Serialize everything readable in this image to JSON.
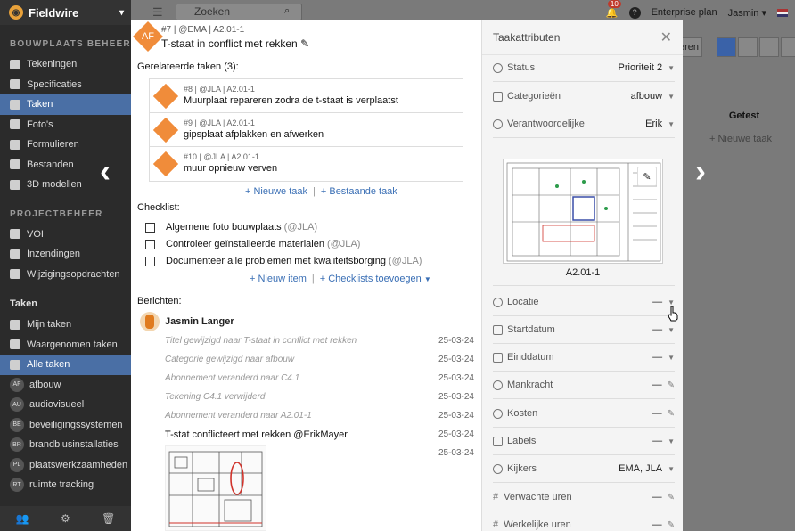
{
  "app": {
    "brand": "Fieldwire"
  },
  "sidebar": {
    "section1": "BOUWPLAATS BEHEER",
    "items1": [
      "Tekeningen",
      "Specificaties",
      "Taken",
      "Foto's",
      "Formulieren",
      "Bestanden",
      "3D modellen"
    ],
    "section2": "PROJECTBEHEER",
    "items2": [
      "VOI",
      "Inzendingen",
      "Wijzigingsopdrachten"
    ],
    "section3": "Taken",
    "items3": [
      "Mijn taken",
      "Waargenomen taken",
      "Alle taken"
    ],
    "cats": [
      {
        "code": "AF",
        "label": "afbouw"
      },
      {
        "code": "AU",
        "label": "audiovisueel"
      },
      {
        "code": "BE",
        "label": "beveiligingssystemen"
      },
      {
        "code": "BR",
        "label": "brandblusinstallaties"
      },
      {
        "code": "PL",
        "label": "plaatswerkzaamheden"
      },
      {
        "code": "RT",
        "label": "ruimte tracking"
      }
    ]
  },
  "topbar": {
    "search_placeholder": "Zoeken",
    "notif_count": "10",
    "plan": "Enterprise plan",
    "user": "Jasmin"
  },
  "background": {
    "column": "Getest",
    "new_task": "+ Nieuwe taak",
    "btn": "eren"
  },
  "task": {
    "avatar": "AF",
    "meta": "#7 | @EMA | A2.01-1",
    "title": "T-staat in conflict met rekken",
    "related_label": "Gerelateerde taken (3):",
    "related": [
      {
        "meta": "#8 | @JLA | A2.01-1",
        "title": "Muurplaat repareren zodra de t-staat is verplaatst"
      },
      {
        "meta": "#9 | @JLA | A2.01-1",
        "title": "gipsplaat afplakken en afwerken"
      },
      {
        "meta": "#10 | @JLA | A2.01-1",
        "title": "muur opnieuw verven"
      }
    ],
    "new_task": "+ Nieuwe taak",
    "existing_task": "+ Bestaande taak",
    "checklist_label": "Checklist:",
    "checklist": [
      {
        "text": "Algemene foto bouwplaats",
        "who": "(@JLA)"
      },
      {
        "text": "Controleer geïnstalleerde materialen",
        "who": "(@JLA)"
      },
      {
        "text": "Documenteer alle problemen met kwaliteitsborging",
        "who": "(@JLA)"
      }
    ],
    "new_item": "+ Nieuw item",
    "add_checklists": "+ Checklists toevoegen",
    "messages_label": "Berichten:",
    "author": "Jasmin Langer",
    "activity": [
      {
        "text": "Titel gewijzigd naar T-staat in conflict met rekken",
        "date": "25-03-24"
      },
      {
        "text": "Categorie gewijzigd naar afbouw",
        "date": "25-03-24"
      },
      {
        "text": "Abonnement veranderd naar C4.1",
        "date": "25-03-24"
      },
      {
        "text": "Tekening C4.1 verwijderd",
        "date": "25-03-24"
      },
      {
        "text": "Abonnement veranderd naar A2.01-1",
        "date": "25-03-24"
      }
    ],
    "message": "T-stat conflicteert met rekken @ErikMayer",
    "message_date": "25-03-24",
    "photo_date": "25-03-24"
  },
  "attrs": {
    "title": "Taakattributen",
    "status": {
      "label": "Status",
      "value": "Prioriteit 2"
    },
    "categories": {
      "label": "Categorieën",
      "value": "afbouw"
    },
    "owner": {
      "label": "Verantwoordelijke",
      "value": "Erik"
    },
    "plan_name": "A2.01-1",
    "location": {
      "label": "Locatie",
      "value": "—"
    },
    "start": {
      "label": "Startdatum",
      "value": "—"
    },
    "end": {
      "label": "Einddatum",
      "value": "—"
    },
    "manpower": {
      "label": "Mankracht",
      "value": "—"
    },
    "costs": {
      "label": "Kosten",
      "value": "—"
    },
    "labels": {
      "label": "Labels",
      "value": "—"
    },
    "watchers": {
      "label": "Kijkers",
      "value": "EMA, JLA"
    },
    "expected": {
      "label": "Verwachte uren",
      "value": "—"
    },
    "actual": {
      "label": "Werkelijke uren",
      "value": "—"
    }
  }
}
